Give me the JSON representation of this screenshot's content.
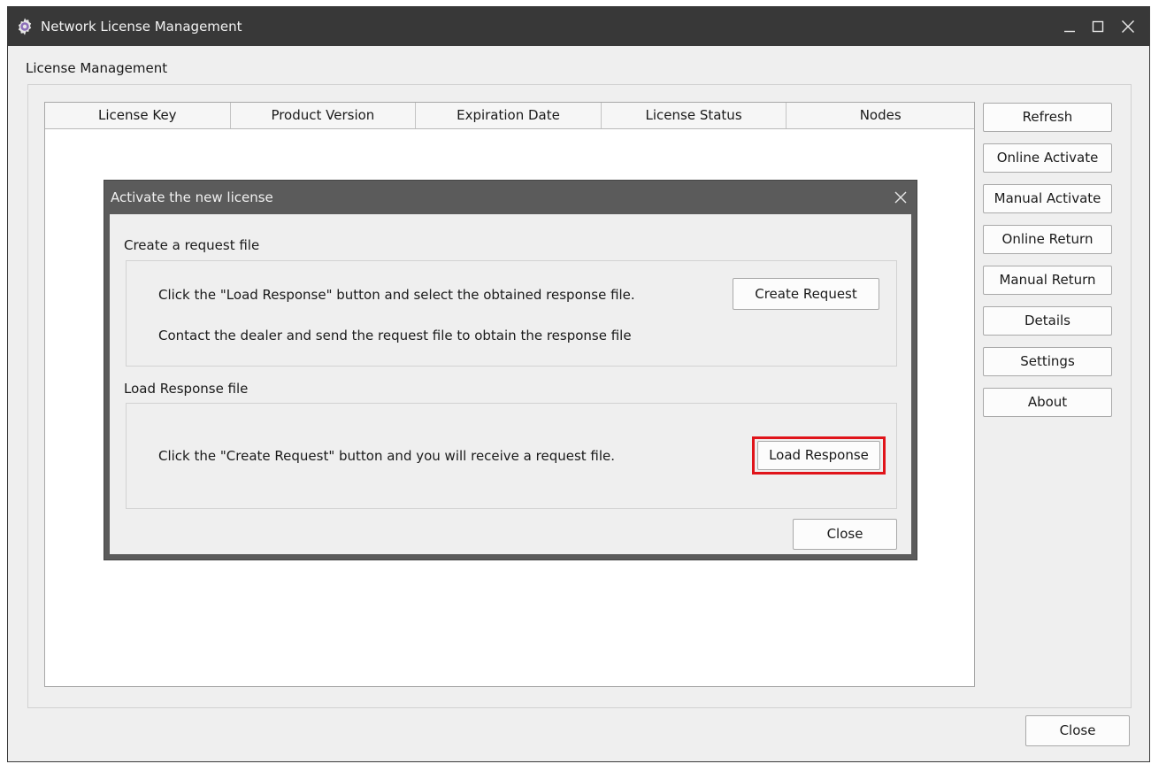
{
  "window": {
    "title": "Network License Management",
    "icon": "gear-icon",
    "controls": {
      "minimize_icon": "minimize-icon",
      "maximize_icon": "maximize-icon",
      "close_icon": "close-icon"
    }
  },
  "main": {
    "section_label": "License Management",
    "table": {
      "columns": [
        "License Key",
        "Product Version",
        "Expiration Date",
        "License Status",
        "Nodes"
      ],
      "rows": []
    },
    "side_buttons": {
      "refresh": "Refresh",
      "online_activate": "Online Activate",
      "manual_activate": "Manual Activate",
      "online_return": "Online Return",
      "manual_return": "Manual Return",
      "details": "Details",
      "settings": "Settings",
      "about": "About"
    },
    "close_label": "Close"
  },
  "dialog": {
    "title": "Activate the new license",
    "request_section": {
      "label": "Create a request file",
      "line1": "Click the \"Load Response\" button and select the obtained response file.",
      "line2": "Contact the dealer and send the request file to obtain the response file",
      "button": "Create Request"
    },
    "response_section": {
      "label": "Load Response file",
      "line1": "Click the \"Create Request\" button and you will receive a request file.",
      "button": "Load Response"
    },
    "close_label": "Close"
  },
  "colors": {
    "titlebar": "#383838",
    "window_bg": "#efefef",
    "dialog_frame": "#5b5b5b",
    "highlight": "#e0141a"
  }
}
